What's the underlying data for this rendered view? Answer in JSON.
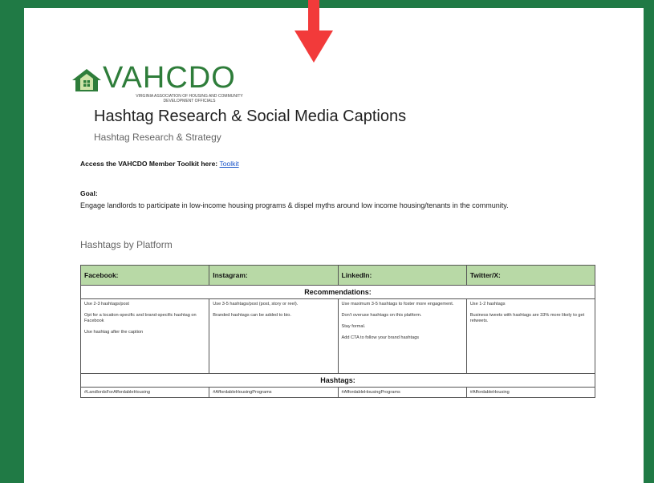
{
  "logo": {
    "wordmark": "VAHCDO",
    "tagline": "VIRGINIA ASSOCIATION OF HOUSING AND COMMUNITY DEVELOPMENT OFFICIALS",
    "green": "#2e7d3a"
  },
  "document": {
    "title": "Hashtag Research & Social Media Captions",
    "subtitle": "Hashtag Research & Strategy",
    "access_label": "Access the VAHCDO Member Toolkit here:",
    "access_link": "Toolkit",
    "goal_heading": "Goal:",
    "goal_text": "Engage landlords to participate in low-income housing programs & dispel myths around low income housing/tenants in the community.",
    "section_heading": "Hashtags by Platform"
  },
  "table": {
    "headers": [
      "Facebook:",
      "Instagram:",
      "LinkedIn:",
      "Twitter/X:"
    ],
    "recommendations_label": "Recommendations:",
    "recommendations": [
      [
        "Use 2-3 hashtags/post",
        "Opt for a location-specific and brand-specific hashtag on Facebook",
        "Use hashtag after the caption"
      ],
      [
        "Use 3-5 hashtags/post (post, story or reel).",
        "Branded hashtags can be added to bio."
      ],
      [
        "Use maximum 3-5 hashtags to foster more engagement.",
        "Don't overuse hashtags on this platform.",
        "Stay formal.",
        "Add CTA to follow your brand hashtags"
      ],
      [
        "Use 1-2 hashtags",
        "Business tweets with hashtags are 33% more likely to get retweets."
      ]
    ],
    "hashtags_label": "Hashtags:",
    "hashtags": [
      "#LandlordsForAffordableHousing",
      "#AffordableHousingPrograms",
      "#AffordableHousingPrograms",
      "#AffordableHousing"
    ],
    "header_color": "#b8d9a6"
  },
  "colors": {
    "background": "#207a45",
    "arrow": "#f23a3a"
  }
}
